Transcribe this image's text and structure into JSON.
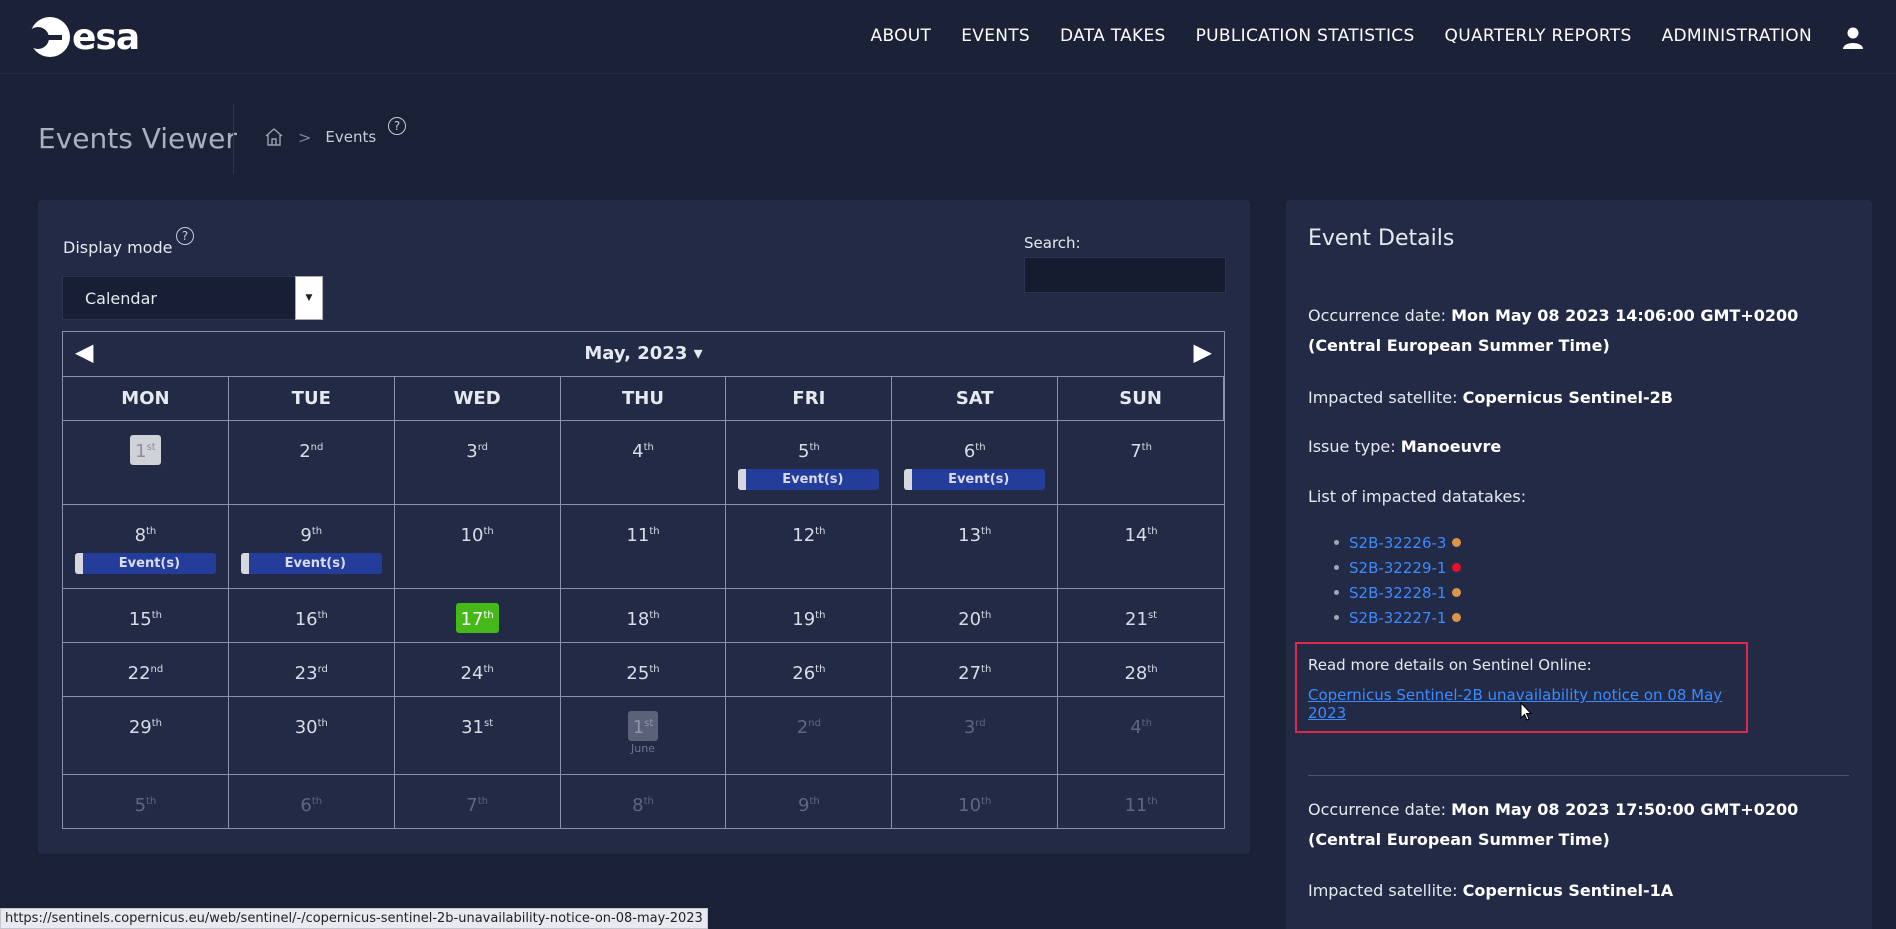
{
  "header": {
    "logo_text": "esa",
    "nav": [
      "ABOUT",
      "EVENTS",
      "DATA TAKES",
      "PUBLICATION STATISTICS",
      "QUARTERLY REPORTS",
      "ADMINISTRATION"
    ]
  },
  "page": {
    "title": "Events Viewer",
    "breadcrumb_current": "Events"
  },
  "controls": {
    "display_mode_label": "Display mode",
    "display_mode_value": "Calendar",
    "search_label": "Search:",
    "search_value": ""
  },
  "calendar": {
    "title": "May, 2023 ▾",
    "prev": "◀",
    "next": "▶",
    "weekdays": [
      "MON",
      "TUE",
      "WED",
      "THU",
      "FRI",
      "SAT",
      "SUN"
    ],
    "event_label": "Event(s)",
    "next_month_tag": "June",
    "weeks": [
      [
        {
          "n": "1",
          "s": "st",
          "t": "first"
        },
        {
          "n": "2",
          "s": "nd"
        },
        {
          "n": "3",
          "s": "rd"
        },
        {
          "n": "4",
          "s": "th"
        },
        {
          "n": "5",
          "s": "th",
          "ev": true
        },
        {
          "n": "6",
          "s": "th",
          "ev": true
        },
        {
          "n": "7",
          "s": "th"
        }
      ],
      [
        {
          "n": "8",
          "s": "th",
          "ev": true
        },
        {
          "n": "9",
          "s": "th",
          "ev": true
        },
        {
          "n": "10",
          "s": "th"
        },
        {
          "n": "11",
          "s": "th"
        },
        {
          "n": "12",
          "s": "th"
        },
        {
          "n": "13",
          "s": "th"
        },
        {
          "n": "14",
          "s": "th"
        }
      ],
      [
        {
          "n": "15",
          "s": "th"
        },
        {
          "n": "16",
          "s": "th"
        },
        {
          "n": "17",
          "s": "th",
          "t": "today"
        },
        {
          "n": "18",
          "s": "th"
        },
        {
          "n": "19",
          "s": "th"
        },
        {
          "n": "20",
          "s": "th"
        },
        {
          "n": "21",
          "s": "st"
        }
      ],
      [
        {
          "n": "22",
          "s": "nd"
        },
        {
          "n": "23",
          "s": "rd"
        },
        {
          "n": "24",
          "s": "th"
        },
        {
          "n": "25",
          "s": "th"
        },
        {
          "n": "26",
          "s": "th"
        },
        {
          "n": "27",
          "s": "th"
        },
        {
          "n": "28",
          "s": "th"
        }
      ],
      [
        {
          "n": "29",
          "s": "th"
        },
        {
          "n": "30",
          "s": "th"
        },
        {
          "n": "31",
          "s": "st"
        },
        {
          "n": "1",
          "s": "st",
          "t": "nextfirst"
        },
        {
          "n": "2",
          "s": "nd",
          "t": "muted"
        },
        {
          "n": "3",
          "s": "rd",
          "t": "muted"
        },
        {
          "n": "4",
          "s": "th",
          "t": "muted"
        }
      ],
      [
        {
          "n": "5",
          "s": "th",
          "t": "muted"
        },
        {
          "n": "6",
          "s": "th",
          "t": "muted"
        },
        {
          "n": "7",
          "s": "th",
          "t": "muted"
        },
        {
          "n": "8",
          "s": "th",
          "t": "muted"
        },
        {
          "n": "9",
          "s": "th",
          "t": "muted"
        },
        {
          "n": "10",
          "s": "th",
          "t": "muted"
        },
        {
          "n": "11",
          "s": "th",
          "t": "muted"
        }
      ]
    ]
  },
  "details": {
    "title": "Event Details",
    "event1": {
      "occurrence_label": "Occurrence date:",
      "occurrence_value": "Mon May 08 2023 14:06:00 GMT+0200 (Central European Summer Time)",
      "satellite_label": "Impacted satellite:",
      "satellite_value": "Copernicus Sentinel-2B",
      "issue_label": "Issue type:",
      "issue_value": "Manoeuvre",
      "datatakes_label": "List of impacted datatakes:",
      "datatakes": [
        {
          "id": "S2B-32226-3",
          "color": "#d9954a"
        },
        {
          "id": "S2B-32229-1",
          "color": "#e8102a"
        },
        {
          "id": "S2B-32228-1",
          "color": "#d9954a"
        },
        {
          "id": "S2B-32227-1",
          "color": "#d9954a"
        }
      ],
      "read_more_label": "Read more details on Sentinel Online:",
      "read_more_link": "Copernicus Sentinel-2B unavailability notice on 08 May 2023"
    },
    "event2": {
      "occurrence_label": "Occurrence date:",
      "occurrence_value": "Mon May 08 2023 17:50:00 GMT+0200 (Central European Summer Time)",
      "satellite_label": "Impacted satellite:",
      "satellite_value": "Copernicus Sentinel-1A"
    }
  },
  "status_bar": {
    "url": "https://sentinels.copernicus.eu/web/sentinel/-/copernicus-sentinel-2b-unavailability-notice-on-08-may-2023"
  }
}
